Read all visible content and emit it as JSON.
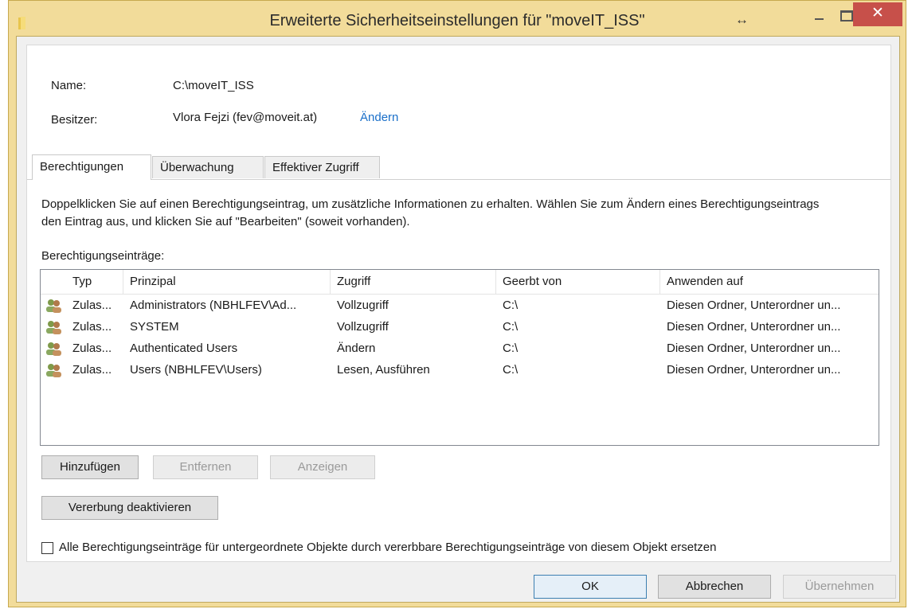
{
  "window": {
    "title": "Erweiterte Sicherheitseinstellungen für \"moveIT_ISS\"",
    "resize_glyph": "↔",
    "close_glyph": "✕"
  },
  "info": {
    "name_label": "Name:",
    "name_value": "C:\\moveIT_ISS",
    "owner_label": "Besitzer:",
    "owner_value": "Vlora Fejzi (fev@moveit.at)",
    "owner_change_link": "Ändern"
  },
  "tabs": [
    {
      "label": "Berechtigungen",
      "active": true
    },
    {
      "label": "Überwachung",
      "active": false
    },
    {
      "label": "Effektiver Zugriff",
      "active": false
    }
  ],
  "description": "Doppelklicken Sie auf einen Berechtigungseintrag, um zusätzliche Informationen zu erhalten. Wählen Sie zum Ändern eines Berechtigungseintrags den Eintrag aus, und klicken Sie auf \"Bearbeiten\" (soweit vorhanden).",
  "entries_label": "Berechtigungseinträge:",
  "table": {
    "columns": [
      "Typ",
      "Prinzipal",
      "Zugriff",
      "Geerbt von",
      "Anwenden auf"
    ],
    "rows": [
      [
        "Zulas...",
        "Administrators (NBHLFEV\\Ad...",
        "Vollzugriff",
        "C:\\",
        "Diesen Ordner, Unterordner un..."
      ],
      [
        "Zulas...",
        "SYSTEM",
        "Vollzugriff",
        "C:\\",
        "Diesen Ordner, Unterordner un..."
      ],
      [
        "Zulas...",
        "Authenticated Users",
        "Ändern",
        "C:\\",
        "Diesen Ordner, Unterordner un..."
      ],
      [
        "Zulas...",
        "Users (NBHLFEV\\Users)",
        "Lesen, Ausführen",
        "C:\\",
        "Diesen Ordner, Unterordner un..."
      ]
    ]
  },
  "buttons": {
    "add": "Hinzufügen",
    "remove": "Entfernen",
    "view": "Anzeigen",
    "disable_inheritance": "Vererbung deaktivieren",
    "ok": "OK",
    "cancel": "Abbrechen",
    "apply": "Übernehmen"
  },
  "replace_checkbox": {
    "label": "Alle Berechtigungseinträge für untergeordnete Objekte durch vererbbare Berechtigungseinträge von diesem Objekt ersetzen",
    "checked": false
  },
  "colors": {
    "frame": "#f2dc9a",
    "close": "#c7504a",
    "link": "#1a6fc9"
  }
}
